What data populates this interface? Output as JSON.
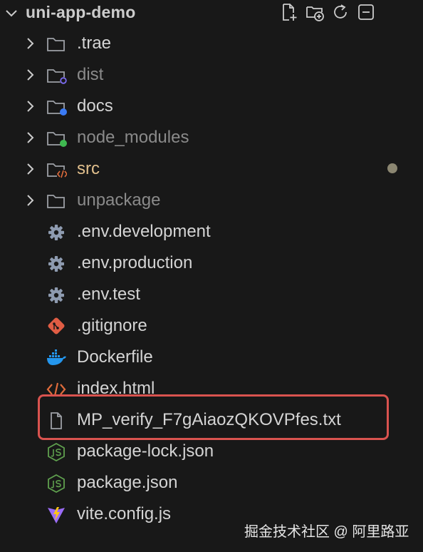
{
  "explorer": {
    "title": "uni-app-demo",
    "actions": [
      {
        "icon": "new-file-icon"
      },
      {
        "icon": "new-folder-icon"
      },
      {
        "icon": "refresh-icon"
      },
      {
        "icon": "collapse-all-icon"
      }
    ]
  },
  "tree": {
    "folders": [
      {
        "label": ".trae",
        "badge": null
      },
      {
        "label": "dist",
        "badge": "#7c6cf2"
      },
      {
        "label": "docs",
        "badge": "#3b7bf5"
      },
      {
        "label": "node_modules",
        "badge": "#3fb950"
      },
      {
        "label": "src",
        "badge": "source"
      },
      {
        "label": "unpackage",
        "badge": null
      }
    ],
    "files": [
      {
        "label": ".env.development",
        "icon": "gear-icon"
      },
      {
        "label": ".env.production",
        "icon": "gear-icon"
      },
      {
        "label": ".env.test",
        "icon": "gear-icon"
      },
      {
        "label": ".gitignore",
        "icon": "git-icon"
      },
      {
        "label": "Dockerfile",
        "icon": "docker-icon"
      },
      {
        "label": "index.html",
        "icon": "html-icon"
      },
      {
        "label": "MP_verify_F7gAiaozQKOVPfes.txt",
        "icon": "text-file-icon"
      },
      {
        "label": "package-lock.json",
        "icon": "nodejs-icon"
      },
      {
        "label": "package.json",
        "icon": "nodejs-icon"
      },
      {
        "label": "vite.config.js",
        "icon": "vite-icon"
      }
    ]
  },
  "colors": {
    "background": "#181818",
    "highlight_border": "#d9534f",
    "modified_text": "#e2c08d"
  },
  "watermark": "掘金技术社区 @ 阿里路亚"
}
